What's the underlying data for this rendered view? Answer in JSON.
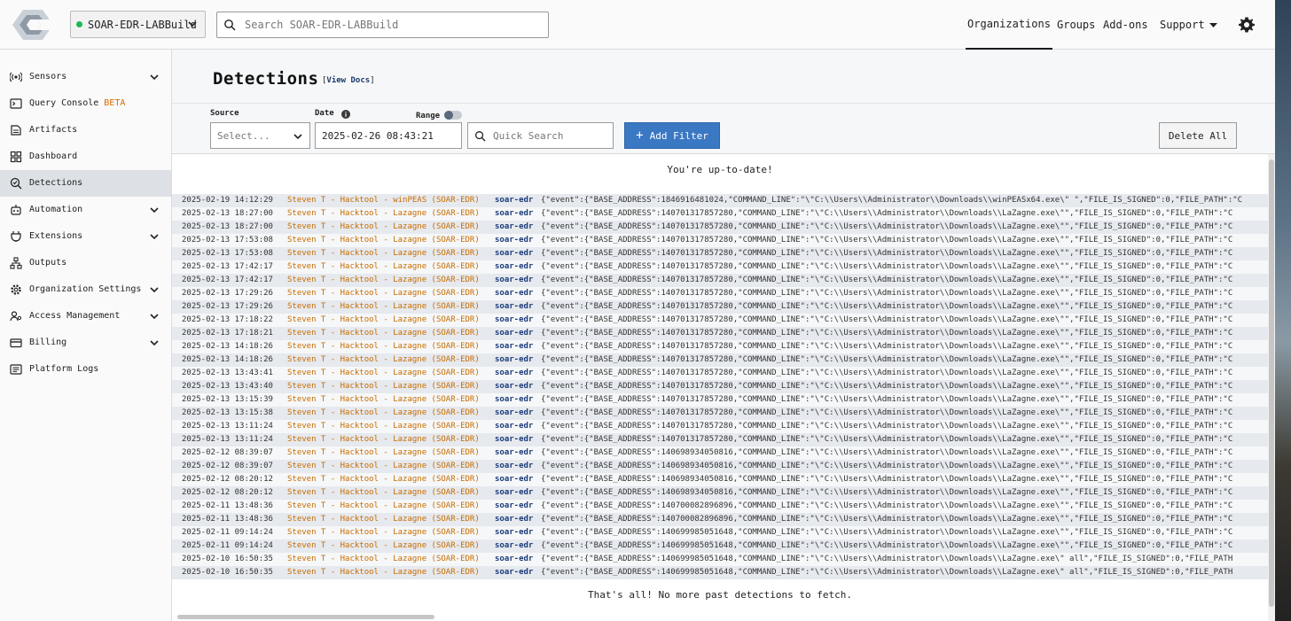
{
  "header": {
    "org_name": "SOAR-EDR-LABBuild",
    "org_status_color": "#1db954",
    "search_placeholder": "Search SOAR-EDR-LABBuild",
    "nav": {
      "organizations": "Organizations",
      "groups": "Groups",
      "addons": "Add-ons",
      "support": "Support"
    },
    "settings_icon": "gear-icon"
  },
  "sidebar": {
    "items": [
      {
        "label": "Sensors",
        "icon": "sensors-icon",
        "expandable": true
      },
      {
        "label": "Query Console",
        "badge": "BETA",
        "icon": "terminal-icon",
        "expandable": false
      },
      {
        "label": "Artifacts",
        "icon": "artifacts-icon",
        "expandable": false
      },
      {
        "label": "Dashboard",
        "icon": "dashboard-icon",
        "expandable": false
      },
      {
        "label": "Detections",
        "icon": "detections-icon",
        "expandable": false,
        "active": true
      },
      {
        "label": "Automation",
        "icon": "automation-icon",
        "expandable": true
      },
      {
        "label": "Extensions",
        "icon": "extensions-icon",
        "expandable": true
      },
      {
        "label": "Outputs",
        "icon": "outputs-icon",
        "expandable": false
      },
      {
        "label": "Organization Settings",
        "icon": "settings-icon",
        "expandable": true
      },
      {
        "label": "Access Management",
        "icon": "access-icon",
        "expandable": true
      },
      {
        "label": "Billing",
        "icon": "billing-icon",
        "expandable": true
      },
      {
        "label": "Platform Logs",
        "icon": "logs-icon",
        "expandable": false
      }
    ]
  },
  "page": {
    "title": "Detections",
    "view_docs": "View Docs",
    "doc_bracket_open": "[",
    "doc_bracket_close": "]"
  },
  "filters": {
    "source_label": "Source",
    "source_placeholder": "Select...",
    "date_label": "Date",
    "date_value": "2025-02-26 08:43:21",
    "range_label": "Range",
    "range_on": false,
    "quick_search_placeholder": "Quick Search",
    "add_filter": "Add Filter",
    "add_filter_plus": "+",
    "delete_all": "Delete All"
  },
  "status": {
    "up_to_date": "You're up-to-date!",
    "thats_all": "That's all! No more past detections to fetch."
  },
  "detections": [
    {
      "ts": "2025-02-19 14:12:29",
      "name": "Steven T - Hacktool - winPEAS (SOAR-EDR)",
      "host": "soar-edr",
      "event": "{\"event\":{\"BASE_ADDRESS\":1846916481024,\"COMMAND_LINE\":\"\\\"C:\\\\Users\\\\Administrator\\\\Downloads\\\\winPEASx64.exe\\\" \",\"FILE_IS_SIGNED\":0,\"FILE_PATH\":\"C"
    },
    {
      "ts": "2025-02-13 18:27:00",
      "name": "Steven T - Hacktool - Lazagne (SOAR-EDR)",
      "host": "soar-edr",
      "event": "{\"event\":{\"BASE_ADDRESS\":140701317857280,\"COMMAND_LINE\":\"\\\"C:\\\\Users\\\\Administrator\\\\Downloads\\\\LaZagne.exe\\\"\",\"FILE_IS_SIGNED\":0,\"FILE_PATH\":\"C"
    },
    {
      "ts": "2025-02-13 18:27:00",
      "name": "Steven T - Hacktool - Lazagne (SOAR-EDR)",
      "host": "soar-edr",
      "event": "{\"event\":{\"BASE_ADDRESS\":140701317857280,\"COMMAND_LINE\":\"\\\"C:\\\\Users\\\\Administrator\\\\Downloads\\\\LaZagne.exe\\\"\",\"FILE_IS_SIGNED\":0,\"FILE_PATH\":\"C"
    },
    {
      "ts": "2025-02-13 17:53:08",
      "name": "Steven T - Hacktool - Lazagne (SOAR-EDR)",
      "host": "soar-edr",
      "event": "{\"event\":{\"BASE_ADDRESS\":140701317857280,\"COMMAND_LINE\":\"\\\"C:\\\\Users\\\\Administrator\\\\Downloads\\\\LaZagne.exe\\\"\",\"FILE_IS_SIGNED\":0,\"FILE_PATH\":\"C"
    },
    {
      "ts": "2025-02-13 17:53:08",
      "name": "Steven T - Hacktool - Lazagne (SOAR-EDR)",
      "host": "soar-edr",
      "event": "{\"event\":{\"BASE_ADDRESS\":140701317857280,\"COMMAND_LINE\":\"\\\"C:\\\\Users\\\\Administrator\\\\Downloads\\\\LaZagne.exe\\\"\",\"FILE_IS_SIGNED\":0,\"FILE_PATH\":\"C"
    },
    {
      "ts": "2025-02-13 17:42:17",
      "name": "Steven T - Hacktool - Lazagne (SOAR-EDR)",
      "host": "soar-edr",
      "event": "{\"event\":{\"BASE_ADDRESS\":140701317857280,\"COMMAND_LINE\":\"\\\"C:\\\\Users\\\\Administrator\\\\Downloads\\\\LaZagne.exe\\\"\",\"FILE_IS_SIGNED\":0,\"FILE_PATH\":\"C"
    },
    {
      "ts": "2025-02-13 17:42:17",
      "name": "Steven T - Hacktool - Lazagne (SOAR-EDR)",
      "host": "soar-edr",
      "event": "{\"event\":{\"BASE_ADDRESS\":140701317857280,\"COMMAND_LINE\":\"\\\"C:\\\\Users\\\\Administrator\\\\Downloads\\\\LaZagne.exe\\\"\",\"FILE_IS_SIGNED\":0,\"FILE_PATH\":\"C"
    },
    {
      "ts": "2025-02-13 17:29:26",
      "name": "Steven T - Hacktool - Lazagne (SOAR-EDR)",
      "host": "soar-edr",
      "event": "{\"event\":{\"BASE_ADDRESS\":140701317857280,\"COMMAND_LINE\":\"\\\"C:\\\\Users\\\\Administrator\\\\Downloads\\\\LaZagne.exe\\\"\",\"FILE_IS_SIGNED\":0,\"FILE_PATH\":\"C"
    },
    {
      "ts": "2025-02-13 17:29:26",
      "name": "Steven T - Hacktool - Lazagne (SOAR-EDR)",
      "host": "soar-edr",
      "event": "{\"event\":{\"BASE_ADDRESS\":140701317857280,\"COMMAND_LINE\":\"\\\"C:\\\\Users\\\\Administrator\\\\Downloads\\\\LaZagne.exe\\\"\",\"FILE_IS_SIGNED\":0,\"FILE_PATH\":\"C"
    },
    {
      "ts": "2025-02-13 17:18:22",
      "name": "Steven T - Hacktool - Lazagne (SOAR-EDR)",
      "host": "soar-edr",
      "event": "{\"event\":{\"BASE_ADDRESS\":140701317857280,\"COMMAND_LINE\":\"\\\"C:\\\\Users\\\\Administrator\\\\Downloads\\\\LaZagne.exe\\\"\",\"FILE_IS_SIGNED\":0,\"FILE_PATH\":\"C"
    },
    {
      "ts": "2025-02-13 17:18:21",
      "name": "Steven T - Hacktool - Lazagne (SOAR-EDR)",
      "host": "soar-edr",
      "event": "{\"event\":{\"BASE_ADDRESS\":140701317857280,\"COMMAND_LINE\":\"\\\"C:\\\\Users\\\\Administrator\\\\Downloads\\\\LaZagne.exe\\\"\",\"FILE_IS_SIGNED\":0,\"FILE_PATH\":\"C"
    },
    {
      "ts": "2025-02-13 14:18:26",
      "name": "Steven T - Hacktool - Lazagne (SOAR-EDR)",
      "host": "soar-edr",
      "event": "{\"event\":{\"BASE_ADDRESS\":140701317857280,\"COMMAND_LINE\":\"\\\"C:\\\\Users\\\\Administrator\\\\Downloads\\\\LaZagne.exe\\\"\",\"FILE_IS_SIGNED\":0,\"FILE_PATH\":\"C"
    },
    {
      "ts": "2025-02-13 14:18:26",
      "name": "Steven T - Hacktool - Lazagne (SOAR-EDR)",
      "host": "soar-edr",
      "event": "{\"event\":{\"BASE_ADDRESS\":140701317857280,\"COMMAND_LINE\":\"\\\"C:\\\\Users\\\\Administrator\\\\Downloads\\\\LaZagne.exe\\\"\",\"FILE_IS_SIGNED\":0,\"FILE_PATH\":\"C"
    },
    {
      "ts": "2025-02-13 13:43:41",
      "name": "Steven T - Hacktool - Lazagne (SOAR-EDR)",
      "host": "soar-edr",
      "event": "{\"event\":{\"BASE_ADDRESS\":140701317857280,\"COMMAND_LINE\":\"\\\"C:\\\\Users\\\\Administrator\\\\Downloads\\\\LaZagne.exe\\\"\",\"FILE_IS_SIGNED\":0,\"FILE_PATH\":\"C"
    },
    {
      "ts": "2025-02-13 13:43:40",
      "name": "Steven T - Hacktool - Lazagne (SOAR-EDR)",
      "host": "soar-edr",
      "event": "{\"event\":{\"BASE_ADDRESS\":140701317857280,\"COMMAND_LINE\":\"\\\"C:\\\\Users\\\\Administrator\\\\Downloads\\\\LaZagne.exe\\\"\",\"FILE_IS_SIGNED\":0,\"FILE_PATH\":\"C"
    },
    {
      "ts": "2025-02-13 13:15:39",
      "name": "Steven T - Hacktool - Lazagne (SOAR-EDR)",
      "host": "soar-edr",
      "event": "{\"event\":{\"BASE_ADDRESS\":140701317857280,\"COMMAND_LINE\":\"\\\"C:\\\\Users\\\\Administrator\\\\Downloads\\\\LaZagne.exe\\\"\",\"FILE_IS_SIGNED\":0,\"FILE_PATH\":\"C"
    },
    {
      "ts": "2025-02-13 13:15:38",
      "name": "Steven T - Hacktool - Lazagne (SOAR-EDR)",
      "host": "soar-edr",
      "event": "{\"event\":{\"BASE_ADDRESS\":140701317857280,\"COMMAND_LINE\":\"\\\"C:\\\\Users\\\\Administrator\\\\Downloads\\\\LaZagne.exe\\\"\",\"FILE_IS_SIGNED\":0,\"FILE_PATH\":\"C"
    },
    {
      "ts": "2025-02-13 13:11:24",
      "name": "Steven T - Hacktool - Lazagne (SOAR-EDR)",
      "host": "soar-edr",
      "event": "{\"event\":{\"BASE_ADDRESS\":140701317857280,\"COMMAND_LINE\":\"\\\"C:\\\\Users\\\\Administrator\\\\Downloads\\\\LaZagne.exe\\\"\",\"FILE_IS_SIGNED\":0,\"FILE_PATH\":\"C"
    },
    {
      "ts": "2025-02-13 13:11:24",
      "name": "Steven T - Hacktool - Lazagne (SOAR-EDR)",
      "host": "soar-edr",
      "event": "{\"event\":{\"BASE_ADDRESS\":140701317857280,\"COMMAND_LINE\":\"\\\"C:\\\\Users\\\\Administrator\\\\Downloads\\\\LaZagne.exe\\\"\",\"FILE_IS_SIGNED\":0,\"FILE_PATH\":\"C"
    },
    {
      "ts": "2025-02-12 08:39:07",
      "name": "Steven T - Hacktool - Lazagne (SOAR-EDR)",
      "host": "soar-edr",
      "event": "{\"event\":{\"BASE_ADDRESS\":140698934050816,\"COMMAND_LINE\":\"\\\"C:\\\\Users\\\\Administrator\\\\Downloads\\\\LaZagne.exe\\\"\",\"FILE_IS_SIGNED\":0,\"FILE_PATH\":\"C"
    },
    {
      "ts": "2025-02-12 08:39:07",
      "name": "Steven T - Hacktool - Lazagne (SOAR-EDR)",
      "host": "soar-edr",
      "event": "{\"event\":{\"BASE_ADDRESS\":140698934050816,\"COMMAND_LINE\":\"\\\"C:\\\\Users\\\\Administrator\\\\Downloads\\\\LaZagne.exe\\\"\",\"FILE_IS_SIGNED\":0,\"FILE_PATH\":\"C"
    },
    {
      "ts": "2025-02-12 08:20:12",
      "name": "Steven T - Hacktool - Lazagne (SOAR-EDR)",
      "host": "soar-edr",
      "event": "{\"event\":{\"BASE_ADDRESS\":140698934050816,\"COMMAND_LINE\":\"\\\"C:\\\\Users\\\\Administrator\\\\Downloads\\\\LaZagne.exe\\\"\",\"FILE_IS_SIGNED\":0,\"FILE_PATH\":\"C"
    },
    {
      "ts": "2025-02-12 08:20:12",
      "name": "Steven T - Hacktool - Lazagne (SOAR-EDR)",
      "host": "soar-edr",
      "event": "{\"event\":{\"BASE_ADDRESS\":140698934050816,\"COMMAND_LINE\":\"\\\"C:\\\\Users\\\\Administrator\\\\Downloads\\\\LaZagne.exe\\\"\",\"FILE_IS_SIGNED\":0,\"FILE_PATH\":\"C"
    },
    {
      "ts": "2025-02-11 13:48:36",
      "name": "Steven T - Hacktool - Lazagne (SOAR-EDR)",
      "host": "soar-edr",
      "event": "{\"event\":{\"BASE_ADDRESS\":140700082896896,\"COMMAND_LINE\":\"\\\"C:\\\\Users\\\\Administrator\\\\Downloads\\\\LaZagne.exe\\\"\",\"FILE_IS_SIGNED\":0,\"FILE_PATH\":\"C"
    },
    {
      "ts": "2025-02-11 13:48:36",
      "name": "Steven T - Hacktool - Lazagne (SOAR-EDR)",
      "host": "soar-edr",
      "event": "{\"event\":{\"BASE_ADDRESS\":140700082896896,\"COMMAND_LINE\":\"\\\"C:\\\\Users\\\\Administrator\\\\Downloads\\\\LaZagne.exe\\\"\",\"FILE_IS_SIGNED\":0,\"FILE_PATH\":\"C"
    },
    {
      "ts": "2025-02-11 09:14:24",
      "name": "Steven T - Hacktool - Lazagne (SOAR-EDR)",
      "host": "soar-edr",
      "event": "{\"event\":{\"BASE_ADDRESS\":140699985051648,\"COMMAND_LINE\":\"\\\"C:\\\\Users\\\\Administrator\\\\Downloads\\\\LaZagne.exe\\\"\",\"FILE_IS_SIGNED\":0,\"FILE_PATH\":\"C"
    },
    {
      "ts": "2025-02-11 09:14:24",
      "name": "Steven T - Hacktool - Lazagne (SOAR-EDR)",
      "host": "soar-edr",
      "event": "{\"event\":{\"BASE_ADDRESS\":140699985051648,\"COMMAND_LINE\":\"\\\"C:\\\\Users\\\\Administrator\\\\Downloads\\\\LaZagne.exe\\\"\",\"FILE_IS_SIGNED\":0,\"FILE_PATH\":\"C"
    },
    {
      "ts": "2025-02-10 16:50:35",
      "name": "Steven T - Hacktool - Lazagne (SOAR-EDR)",
      "host": "soar-edr",
      "event": "{\"event\":{\"BASE_ADDRESS\":140699985051648,\"COMMAND_LINE\":\"\\\"C:\\\\Users\\\\Administrator\\\\Downloads\\\\LaZagne.exe\\\" all\",\"FILE_IS_SIGNED\":0,\"FILE_PATH"
    },
    {
      "ts": "2025-02-10 16:50:35",
      "name": "Steven T - Hacktool - Lazagne (SOAR-EDR)",
      "host": "soar-edr",
      "event": "{\"event\":{\"BASE_ADDRESS\":140699985051648,\"COMMAND_LINE\":\"\\\"C:\\\\Users\\\\Administrator\\\\Downloads\\\\LaZagne.exe\\\" all\",\"FILE_IS_SIGNED\":0,\"FILE_PATH"
    }
  ]
}
